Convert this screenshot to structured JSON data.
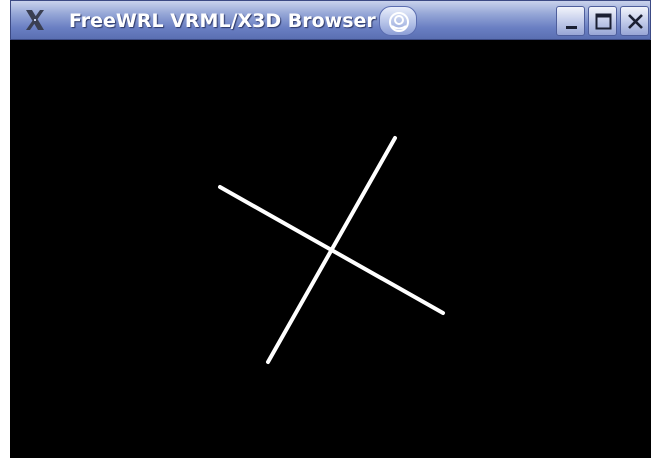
{
  "window": {
    "title": "FreeWRL VRML/X3D Browser"
  },
  "titlebar": {
    "app_icon": "x-logo-icon",
    "shade_button_icon": "shade-swirl-icon",
    "buttons": [
      {
        "name": "minimize",
        "icon": "minimize-icon"
      },
      {
        "name": "maximize",
        "icon": "maximize-icon"
      },
      {
        "name": "close",
        "icon": "close-icon"
      }
    ]
  },
  "scene": {
    "background_color": "#000000",
    "line_color": "#ffffff",
    "object": "cross"
  },
  "colors": {
    "titlebar_top": "#c9d2ec",
    "titlebar_bottom": "#5a6fb2",
    "title_text": "#ffffff"
  }
}
